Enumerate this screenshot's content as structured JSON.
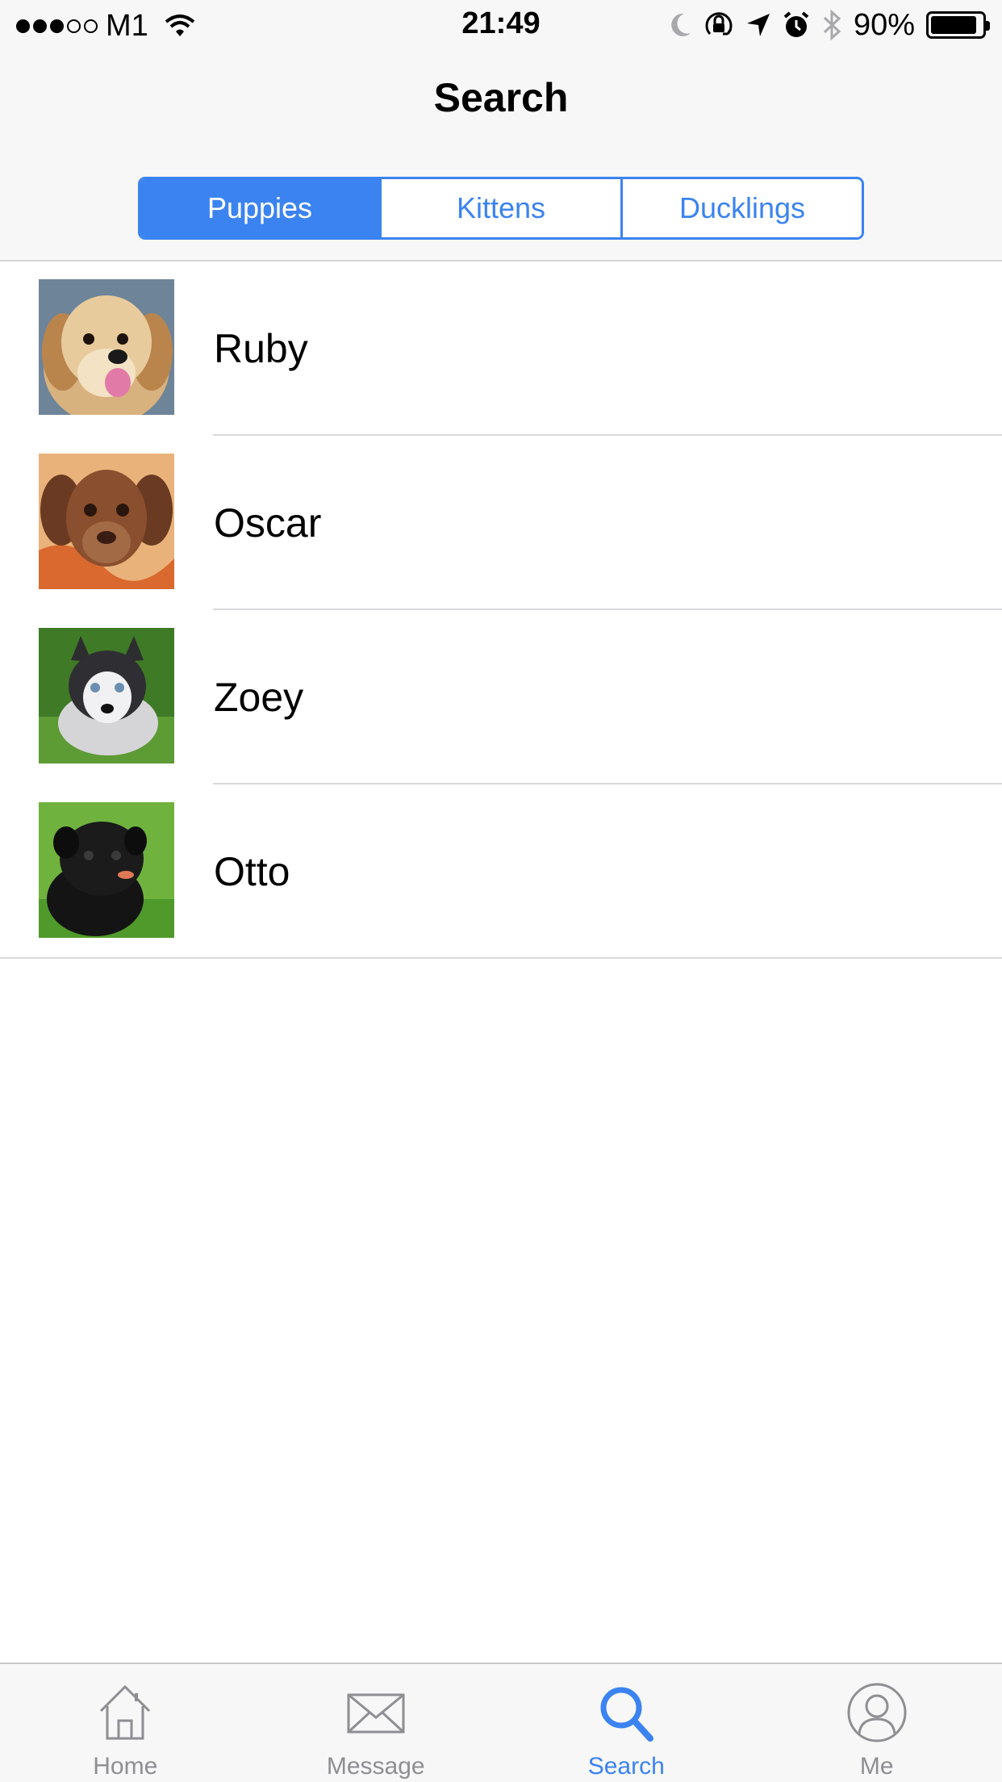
{
  "status_bar": {
    "carrier": "M1",
    "signal_bars_filled": 3,
    "signal_bars_total": 5,
    "time": "21:49",
    "battery_percent_label": "90%",
    "battery_level": 0.9,
    "icons": [
      "wifi-icon",
      "moon-icon",
      "rotation-lock-icon",
      "location-arrow-icon",
      "alarm-icon",
      "bluetooth-icon",
      "battery-icon"
    ]
  },
  "nav": {
    "title": "Search"
  },
  "segmented_control": {
    "segments": [
      {
        "label": "Puppies",
        "selected": true
      },
      {
        "label": "Kittens",
        "selected": false
      },
      {
        "label": "Ducklings",
        "selected": false
      }
    ]
  },
  "list": {
    "items": [
      {
        "name": "Ruby",
        "thumb": "golden-puppy-photo"
      },
      {
        "name": "Oscar",
        "thumb": "brown-puppy-photo"
      },
      {
        "name": "Zoey",
        "thumb": "husky-puppy-photo"
      },
      {
        "name": "Otto",
        "thumb": "black-pug-puppy-photo"
      }
    ]
  },
  "tab_bar": {
    "tabs": [
      {
        "label": "Home",
        "icon": "home-icon",
        "selected": false
      },
      {
        "label": "Message",
        "icon": "envelope-icon",
        "selected": false
      },
      {
        "label": "Search",
        "icon": "search-icon",
        "selected": true
      },
      {
        "label": "Me",
        "icon": "user-icon",
        "selected": false
      }
    ]
  },
  "colors": {
    "accent": "#3b83f0",
    "inactive": "#8e8e93",
    "bar_background": "#f7f7f7",
    "separator": "#d9d9dc"
  }
}
